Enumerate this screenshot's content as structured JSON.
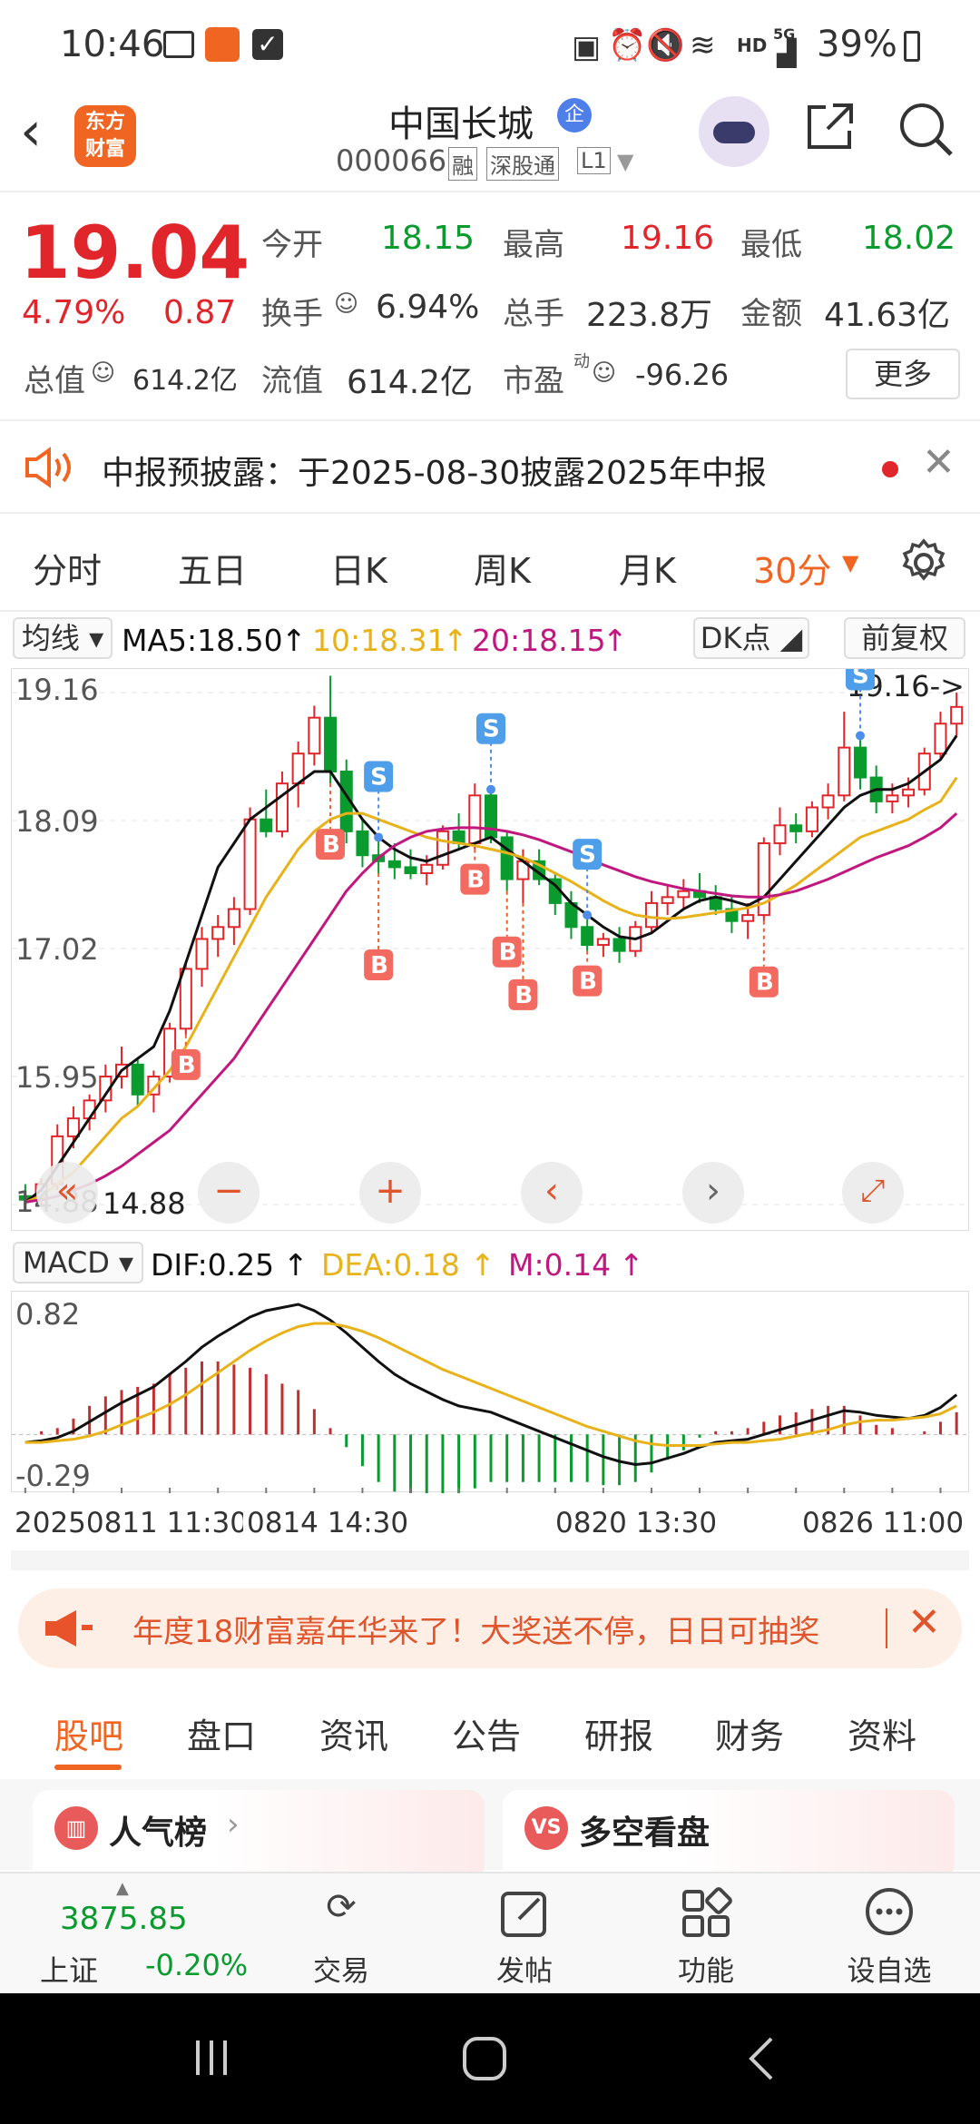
{
  "status": {
    "time": "10:46",
    "network": "HD",
    "signal": "5G",
    "battery": "39%"
  },
  "header": {
    "logo_line1": "东方",
    "logo_line2": "财富",
    "name": "中国长城",
    "badge": "企",
    "code": "000066",
    "tags": [
      "融",
      "深股通",
      "L1"
    ]
  },
  "quote": {
    "price": "19.04",
    "change_pct": "4.79%",
    "change": "0.87",
    "open_label": "今开",
    "open": "18.15",
    "high_label": "最高",
    "high": "19.16",
    "low_label": "最低",
    "low": "18.02",
    "turnover_label": "换手",
    "turnover": "6.94%",
    "volume_label": "总手",
    "volume": "223.8万",
    "amount_label": "金额",
    "amount": "41.63亿",
    "mcap_label": "总值",
    "mcap": "614.2亿",
    "float_label": "流值",
    "float": "614.2亿",
    "pe_label": "市盈",
    "pe_sup": "动",
    "pe": "-96.26",
    "more": "更多"
  },
  "notice": {
    "text": "中报预披露：于2025-08-30披露2025年中报"
  },
  "tabs": [
    "分时",
    "五日",
    "日K",
    "周K",
    "月K",
    "30分"
  ],
  "active_tab": "30分",
  "ma": {
    "selector": "均线",
    "ma5": "MA5:18.50",
    "ma10": "10:18.31",
    "ma20": "20:18.15",
    "dk": "DK点",
    "adjust": "前复权"
  },
  "chart_data": {
    "type": "candlestick",
    "y_ticks": [
      "19.16",
      "18.09",
      "17.02",
      "15.95",
      "14.88"
    ],
    "ylim": [
      14.88,
      19.16
    ],
    "high_label": "19.16->",
    "low_label": "14.88",
    "signals": [
      "B",
      "B",
      "B",
      "B",
      "B",
      "B",
      "B",
      "B",
      "S",
      "S",
      "S",
      "S"
    ],
    "candles": [
      {
        "o": 14.95,
        "h": 15.05,
        "l": 14.85,
        "c": 14.92
      },
      {
        "o": 14.92,
        "h": 15.1,
        "l": 14.88,
        "c": 15.05
      },
      {
        "o": 15.05,
        "h": 15.55,
        "l": 15.0,
        "c": 15.45
      },
      {
        "o": 15.45,
        "h": 15.7,
        "l": 15.35,
        "c": 15.6
      },
      {
        "o": 15.6,
        "h": 15.8,
        "l": 15.5,
        "c": 15.75
      },
      {
        "o": 15.75,
        "h": 16.05,
        "l": 15.65,
        "c": 15.95
      },
      {
        "o": 15.95,
        "h": 16.2,
        "l": 15.85,
        "c": 16.05
      },
      {
        "o": 16.05,
        "h": 16.1,
        "l": 15.7,
        "c": 15.8
      },
      {
        "o": 15.8,
        "h": 16.0,
        "l": 15.65,
        "c": 15.95
      },
      {
        "o": 15.95,
        "h": 16.4,
        "l": 15.9,
        "c": 16.35
      },
      {
        "o": 16.35,
        "h": 16.9,
        "l": 16.3,
        "c": 16.85
      },
      {
        "o": 16.85,
        "h": 17.2,
        "l": 16.7,
        "c": 17.1
      },
      {
        "o": 17.1,
        "h": 17.3,
        "l": 16.95,
        "c": 17.2
      },
      {
        "o": 17.2,
        "h": 17.45,
        "l": 17.05,
        "c": 17.35
      },
      {
        "o": 17.35,
        "h": 18.2,
        "l": 17.3,
        "c": 18.1
      },
      {
        "o": 18.1,
        "h": 18.35,
        "l": 17.95,
        "c": 18.0
      },
      {
        "o": 18.0,
        "h": 18.5,
        "l": 17.95,
        "c": 18.4
      },
      {
        "o": 18.4,
        "h": 18.75,
        "l": 18.2,
        "c": 18.65
      },
      {
        "o": 18.65,
        "h": 19.05,
        "l": 18.55,
        "c": 18.95
      },
      {
        "o": 18.95,
        "h": 19.3,
        "l": 18.4,
        "c": 18.5
      },
      {
        "o": 18.5,
        "h": 18.6,
        "l": 17.9,
        "c": 18.0
      },
      {
        "o": 18.0,
        "h": 18.1,
        "l": 17.7,
        "c": 17.8
      },
      {
        "o": 17.8,
        "h": 17.95,
        "l": 17.65,
        "c": 17.75
      },
      {
        "o": 17.75,
        "h": 17.9,
        "l": 17.6,
        "c": 17.7
      },
      {
        "o": 17.7,
        "h": 17.85,
        "l": 17.6,
        "c": 17.65
      },
      {
        "o": 17.65,
        "h": 17.8,
        "l": 17.55,
        "c": 17.72
      },
      {
        "o": 17.72,
        "h": 18.05,
        "l": 17.68,
        "c": 18.0
      },
      {
        "o": 18.0,
        "h": 18.15,
        "l": 17.85,
        "c": 17.9
      },
      {
        "o": 17.9,
        "h": 18.4,
        "l": 17.85,
        "c": 18.3
      },
      {
        "o": 18.3,
        "h": 18.35,
        "l": 17.9,
        "c": 17.95
      },
      {
        "o": 17.95,
        "h": 18.0,
        "l": 17.5,
        "c": 17.6
      },
      {
        "o": 17.6,
        "h": 17.85,
        "l": 17.4,
        "c": 17.75
      },
      {
        "o": 17.75,
        "h": 17.85,
        "l": 17.55,
        "c": 17.6
      },
      {
        "o": 17.6,
        "h": 17.65,
        "l": 17.3,
        "c": 17.4
      },
      {
        "o": 17.4,
        "h": 17.5,
        "l": 17.1,
        "c": 17.2
      },
      {
        "o": 17.2,
        "h": 17.3,
        "l": 17.0,
        "c": 17.05
      },
      {
        "o": 17.05,
        "h": 17.15,
        "l": 16.95,
        "c": 17.1
      },
      {
        "o": 17.1,
        "h": 17.2,
        "l": 16.9,
        "c": 17.0
      },
      {
        "o": 17.0,
        "h": 17.25,
        "l": 16.95,
        "c": 17.2
      },
      {
        "o": 17.2,
        "h": 17.5,
        "l": 17.15,
        "c": 17.4
      },
      {
        "o": 17.4,
        "h": 17.55,
        "l": 17.3,
        "c": 17.45
      },
      {
        "o": 17.45,
        "h": 17.6,
        "l": 17.35,
        "c": 17.5
      },
      {
        "o": 17.5,
        "h": 17.65,
        "l": 17.4,
        "c": 17.45
      },
      {
        "o": 17.45,
        "h": 17.55,
        "l": 17.3,
        "c": 17.35
      },
      {
        "o": 17.35,
        "h": 17.45,
        "l": 17.15,
        "c": 17.25
      },
      {
        "o": 17.25,
        "h": 17.4,
        "l": 17.1,
        "c": 17.3
      },
      {
        "o": 17.3,
        "h": 17.95,
        "l": 17.25,
        "c": 17.9
      },
      {
        "o": 17.9,
        "h": 18.2,
        "l": 17.8,
        "c": 18.05
      },
      {
        "o": 18.05,
        "h": 18.15,
        "l": 17.9,
        "c": 18.0
      },
      {
        "o": 18.0,
        "h": 18.25,
        "l": 17.95,
        "c": 18.2
      },
      {
        "o": 18.2,
        "h": 18.4,
        "l": 18.1,
        "c": 18.3
      },
      {
        "o": 18.3,
        "h": 19.0,
        "l": 18.25,
        "c": 18.7
      },
      {
        "o": 18.7,
        "h": 18.8,
        "l": 18.35,
        "c": 18.45
      },
      {
        "o": 18.45,
        "h": 18.55,
        "l": 18.15,
        "c": 18.25
      },
      {
        "o": 18.25,
        "h": 18.4,
        "l": 18.15,
        "c": 18.3
      },
      {
        "o": 18.3,
        "h": 18.45,
        "l": 18.2,
        "c": 18.35
      },
      {
        "o": 18.35,
        "h": 18.7,
        "l": 18.3,
        "c": 18.65
      },
      {
        "o": 18.65,
        "h": 19.0,
        "l": 18.6,
        "c": 18.9
      },
      {
        "o": 18.9,
        "h": 19.16,
        "l": 18.8,
        "c": 19.04
      }
    ],
    "ma5": [
      14.9,
      15.0,
      15.2,
      15.4,
      15.6,
      15.8,
      16.0,
      16.1,
      16.2,
      16.5,
      16.9,
      17.3,
      17.7,
      17.9,
      18.1,
      18.2,
      18.3,
      18.4,
      18.5,
      18.5,
      18.3,
      18.1,
      17.95,
      17.85,
      17.78,
      17.75,
      17.8,
      17.85,
      17.9,
      17.95,
      17.85,
      17.75,
      17.65,
      17.55,
      17.4,
      17.3,
      17.2,
      17.12,
      17.1,
      17.15,
      17.25,
      17.35,
      17.42,
      17.45,
      17.42,
      17.38,
      17.45,
      17.6,
      17.75,
      17.9,
      18.05,
      18.2,
      18.3,
      18.35,
      18.35,
      18.4,
      18.5,
      18.6,
      18.8
    ],
    "ma10": [
      14.9,
      14.95,
      15.05,
      15.15,
      15.3,
      15.45,
      15.6,
      15.7,
      15.85,
      16.0,
      16.2,
      16.45,
      16.7,
      16.95,
      17.2,
      17.45,
      17.65,
      17.85,
      18.0,
      18.1,
      18.15,
      18.15,
      18.1,
      18.05,
      18.0,
      17.95,
      17.92,
      17.9,
      17.88,
      17.85,
      17.82,
      17.78,
      17.72,
      17.65,
      17.58,
      17.5,
      17.42,
      17.35,
      17.3,
      17.28,
      17.27,
      17.28,
      17.3,
      17.32,
      17.34,
      17.36,
      17.4,
      17.47,
      17.55,
      17.65,
      17.75,
      17.85,
      17.95,
      18.0,
      18.05,
      18.1,
      18.18,
      18.25,
      18.45
    ],
    "ma20": [
      14.9,
      14.92,
      14.95,
      15.0,
      15.05,
      15.12,
      15.2,
      15.3,
      15.4,
      15.5,
      15.65,
      15.8,
      15.95,
      16.1,
      16.3,
      16.5,
      16.7,
      16.9,
      17.1,
      17.3,
      17.5,
      17.65,
      17.78,
      17.88,
      17.95,
      18.0,
      18.02,
      18.03,
      18.03,
      18.02,
      18.0,
      17.97,
      17.93,
      17.88,
      17.83,
      17.78,
      17.72,
      17.67,
      17.62,
      17.58,
      17.55,
      17.52,
      17.5,
      17.48,
      17.46,
      17.45,
      17.45,
      17.47,
      17.5,
      17.55,
      17.6,
      17.66,
      17.72,
      17.78,
      17.83,
      17.88,
      17.95,
      18.03,
      18.15
    ]
  },
  "macd": {
    "selector": "MACD",
    "dif": "DIF:0.25",
    "dea": "DEA:0.18",
    "m": "M:0.14",
    "y_ticks": [
      "0.82",
      "-0.29"
    ],
    "ylim": [
      -0.29,
      0.82
    ],
    "dif_values": [
      -0.05,
      -0.04,
      -0.02,
      0.02,
      0.08,
      0.14,
      0.2,
      0.25,
      0.3,
      0.38,
      0.46,
      0.55,
      0.62,
      0.68,
      0.74,
      0.78,
      0.8,
      0.82,
      0.78,
      0.72,
      0.64,
      0.55,
      0.46,
      0.38,
      0.32,
      0.27,
      0.22,
      0.18,
      0.16,
      0.14,
      0.1,
      0.06,
      0.02,
      -0.02,
      -0.06,
      -0.1,
      -0.14,
      -0.17,
      -0.19,
      -0.18,
      -0.15,
      -0.12,
      -0.08,
      -0.05,
      -0.04,
      -0.03,
      0.0,
      0.03,
      0.06,
      0.09,
      0.12,
      0.15,
      0.14,
      0.12,
      0.11,
      0.1,
      0.12,
      0.17,
      0.25
    ],
    "dea_values": [
      -0.05,
      -0.05,
      -0.04,
      -0.03,
      -0.01,
      0.02,
      0.06,
      0.1,
      0.14,
      0.19,
      0.25,
      0.32,
      0.39,
      0.46,
      0.53,
      0.59,
      0.64,
      0.68,
      0.7,
      0.7,
      0.68,
      0.65,
      0.61,
      0.56,
      0.51,
      0.46,
      0.41,
      0.37,
      0.33,
      0.29,
      0.25,
      0.21,
      0.17,
      0.13,
      0.09,
      0.05,
      0.02,
      -0.01,
      -0.04,
      -0.06,
      -0.07,
      -0.07,
      -0.07,
      -0.06,
      -0.05,
      -0.05,
      -0.04,
      -0.03,
      -0.01,
      0.01,
      0.03,
      0.06,
      0.08,
      0.09,
      0.09,
      0.1,
      0.11,
      0.13,
      0.18
    ],
    "x_labels": [
      "20250811 11:30",
      "0814 14:30",
      "0820 13:30",
      "0826 11:00"
    ]
  },
  "banner": {
    "text": "年度18财富嘉年华来了！大奖送不停，日日可抽奖"
  },
  "subtabs": [
    "股吧",
    "盘口",
    "资讯",
    "公告",
    "研报",
    "财务",
    "资料"
  ],
  "active_subtab": "股吧",
  "cards": [
    {
      "icon": "VS",
      "label": "人气榜"
    },
    {
      "icon": "VS",
      "label": "多空看盘"
    }
  ],
  "bottom": {
    "index_value": "3875.85",
    "index_name": "上证",
    "index_change": "-0.20%",
    "nav": [
      "交易",
      "发帖",
      "功能",
      "设自选"
    ]
  },
  "colors": {
    "up": "#e0252b",
    "down": "#0a9b2f",
    "accent": "#f06522",
    "ma5": "#111111",
    "ma10": "#e8b21a",
    "ma20": "#c0187e"
  }
}
